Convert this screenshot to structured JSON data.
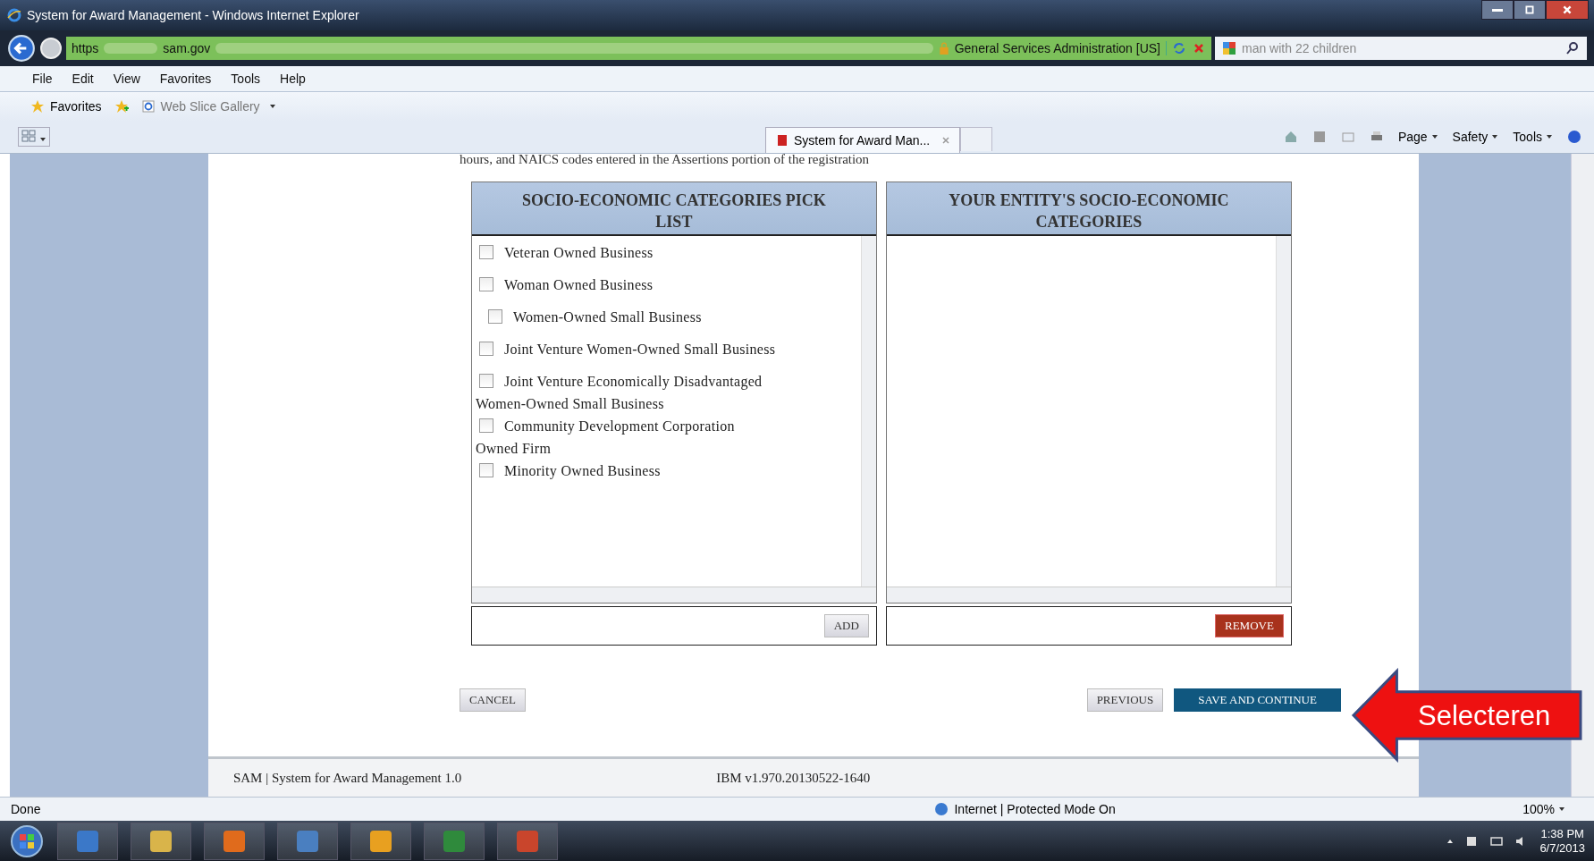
{
  "window": {
    "title": "System for Award Management - Windows Internet Explorer"
  },
  "address_bar": {
    "scheme": "https",
    "host": "sam.gov",
    "site_identity": "General Services Administration [US]"
  },
  "search": {
    "value": "man with 22 children"
  },
  "menu": [
    "File",
    "Edit",
    "View",
    "Favorites",
    "Tools",
    "Help"
  ],
  "favorites_bar": {
    "favorites": "Favorites",
    "web_slice_gallery": "Web Slice Gallery"
  },
  "tabs": [
    {
      "label": "System for Award Man...",
      "selected": true
    }
  ],
  "command_bar": [
    "Page",
    "Safety",
    "Tools"
  ],
  "page": {
    "intro": "hours, and NAICS codes entered in the Assertions portion of the registration",
    "pick_list": {
      "title": "SOCIO-ECONOMIC CATEGORIES PICK LIST",
      "items": [
        {
          "label": "Veteran Owned Business",
          "checked": false
        },
        {
          "label": "Woman Owned Business",
          "checked": false,
          "children": [
            {
              "label": "Women-Owned Small Business",
              "checked": false
            }
          ]
        },
        {
          "label": "Joint Venture Women-Owned Small Business",
          "checked": false
        },
        {
          "label": "Joint Venture Economically Disadvantaged Women-Owned Small Business",
          "checked": false
        },
        {
          "label": "Community Development Corporation Owned Firm",
          "checked": false
        },
        {
          "label": "Minority Owned Business",
          "checked": false
        }
      ]
    },
    "selected_list": {
      "title": "YOUR ENTITY'S SOCIO-ECONOMIC CATEGORIES"
    },
    "add_button": "ADD",
    "remove_button": "REMOVE",
    "cancel_button": "CANCEL",
    "previous_button": "PREVIOUS",
    "save_button": "SAVE AND CONTINUE"
  },
  "footer": {
    "left": "SAM | System for Award Management 1.0",
    "right": "IBM v1.970.20130522-1640"
  },
  "callout": "Selecteren",
  "status_bar": {
    "text": "Done",
    "zone": "Internet | Protected Mode On",
    "zoom": "100%"
  },
  "taskbar": {
    "time": "1:38 PM",
    "date": "6/7/2013"
  }
}
